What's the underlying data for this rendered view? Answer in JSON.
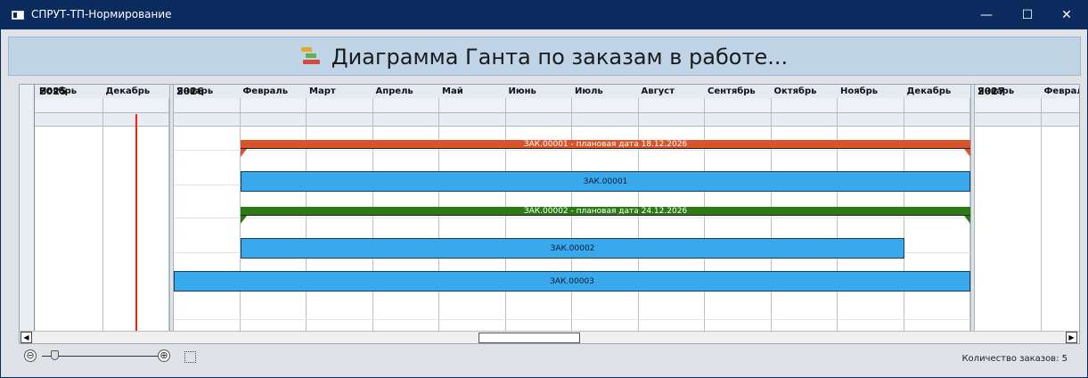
{
  "window": {
    "title": "СПРУТ-ТП-Нормирование",
    "minimize": "—",
    "maximize": "☐",
    "close": "✕"
  },
  "header": {
    "title": "Диаграмма Ганта по заказам в работе...",
    "icon": "gantt-chart-icon"
  },
  "timeline": {
    "years": [
      "2025",
      "2026",
      "2027"
    ],
    "months": [
      {
        "year": "2025",
        "label": "Ноябрь"
      },
      {
        "year": "2025",
        "label": "Декабрь"
      },
      {
        "year": "2026",
        "label": "Январь"
      },
      {
        "year": "2026",
        "label": "Февраль"
      },
      {
        "year": "2026",
        "label": "Март"
      },
      {
        "year": "2026",
        "label": "Апрель"
      },
      {
        "year": "2026",
        "label": "Май"
      },
      {
        "year": "2026",
        "label": "Июнь"
      },
      {
        "year": "2026",
        "label": "Июль"
      },
      {
        "year": "2026",
        "label": "Август"
      },
      {
        "year": "2026",
        "label": "Сентябрь"
      },
      {
        "year": "2026",
        "label": "Октябрь"
      },
      {
        "year": "2026",
        "label": "Ноябрь"
      },
      {
        "year": "2026",
        "label": "Декабрь"
      },
      {
        "year": "2027",
        "label": "Январь"
      },
      {
        "year": "2027",
        "label": "Феврал"
      }
    ],
    "today": "2025-12-16"
  },
  "tasks": [
    {
      "kind": "summary",
      "label": "ЗАК.00001 - плановая дата 18.12.2026",
      "start": "2026-02-01",
      "end": "2026-12-31",
      "color": "#d9532b"
    },
    {
      "kind": "bar",
      "label": "ЗАК.00001",
      "start": "2026-02-01",
      "end": "2026-12-31",
      "color": "#39a9ee"
    },
    {
      "kind": "summary",
      "label": "ЗАК.00002 - плановая дата 24.12.2026",
      "start": "2026-02-01",
      "end": "2026-12-31",
      "color": "#2c7a14"
    },
    {
      "kind": "bar",
      "label": "ЗАК.00002",
      "start": "2026-02-01",
      "end": "2026-11-30",
      "color": "#39a9ee"
    },
    {
      "kind": "bar",
      "label": "ЗАК.00003",
      "start": "2026-01-01",
      "end": "2026-12-31",
      "color": "#39a9ee"
    }
  ],
  "footer": {
    "zoom_out": "⊖",
    "zoom_in": "⊕",
    "count_label": "Количество заказов: 5"
  },
  "scroll": {
    "left": "◀",
    "right": "▶"
  }
}
